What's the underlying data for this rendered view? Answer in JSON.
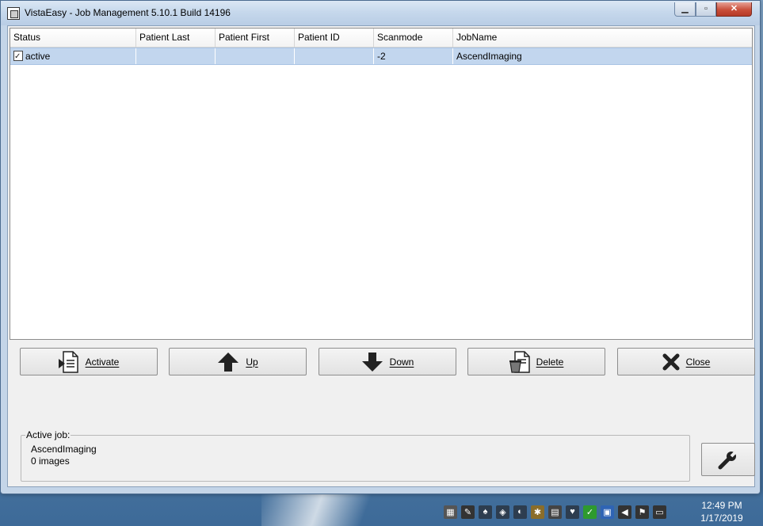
{
  "window": {
    "title": "VistaEasy - Job Management  5.10.1 Build 14196",
    "controls": {
      "minimize": "▁",
      "maximize": "▫",
      "close": "✕"
    }
  },
  "table": {
    "columns": [
      "Status",
      "Patient Last",
      "Patient First",
      "Patient ID",
      "Scanmode",
      "JobName"
    ],
    "rows": [
      {
        "status": "active",
        "patient_last": "",
        "patient_first": "",
        "patient_id": "",
        "scanmode": "-2",
        "jobname": "AscendImaging",
        "status_icon": "checklist-icon"
      }
    ]
  },
  "buttons": {
    "activate": {
      "label": "Activate",
      "icon": "document-arrow-icon"
    },
    "up": {
      "label": "Up",
      "icon": "arrow-up-icon"
    },
    "down": {
      "label": "Down",
      "icon": "arrow-down-icon"
    },
    "delete": {
      "label": "Delete",
      "icon": "trash-document-icon"
    },
    "close": {
      "label": "Close",
      "icon": "x-icon"
    },
    "settings": {
      "icon": "wrench-icon"
    }
  },
  "active_job": {
    "legend": "Active job:",
    "job_name": "AscendImaging",
    "images": "0 images"
  },
  "taskbar": {
    "tray_icons": [
      "app-icon",
      "pen-icon",
      "tooth-icon",
      "shield-icon",
      "headset-icon",
      "tools-icon",
      "clipboard-icon",
      "tooth-icon",
      "check-icon",
      "network-icon",
      "volume-muted-icon",
      "flag-icon",
      "display-icon"
    ],
    "time": "12:49 PM",
    "date": "1/17/2019"
  },
  "colors": {
    "selected_row": "#c2d6ee",
    "window_bg": "#f0f0f0",
    "close_button": "#c94f3a"
  }
}
